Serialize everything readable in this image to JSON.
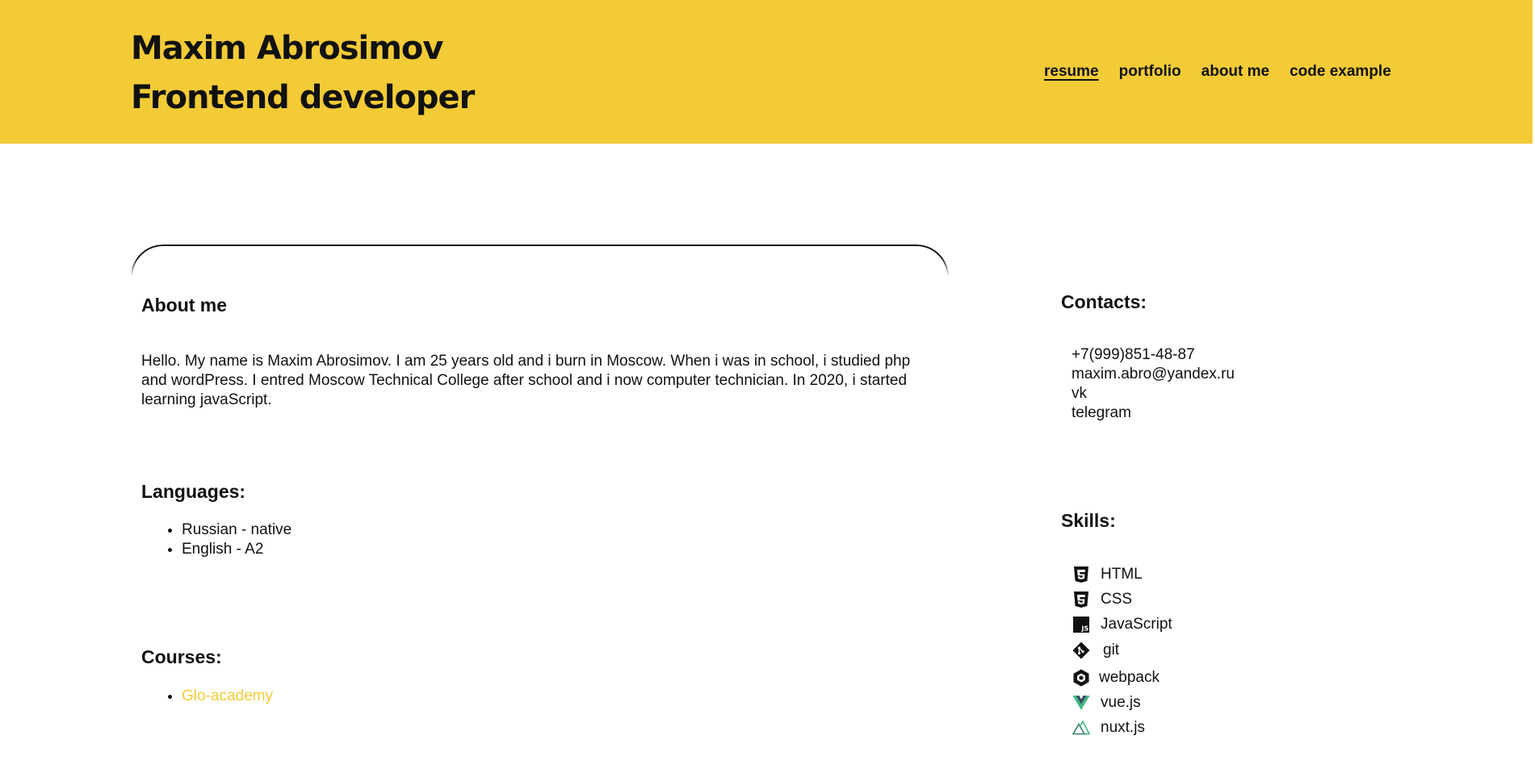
{
  "header": {
    "name": "Maxim Abrosimov",
    "role": "Frontend developer",
    "nav": [
      {
        "label": "resume",
        "active": true
      },
      {
        "label": "portfolio",
        "active": false
      },
      {
        "label": "about me",
        "active": false
      },
      {
        "label": "code example",
        "active": false
      }
    ]
  },
  "about": {
    "heading": "About me",
    "text": "Hello. My name is Maxim Abrosimov. I am 25 years old and i burn in Moscow. When i was in school, i studied php and wordPress. I entred Moscow Technical College after school and i now computer technician. In 2020, i started learning javaScript."
  },
  "languages": {
    "heading": "Languages:",
    "items": [
      "Russian - native",
      "English - A2"
    ]
  },
  "courses": {
    "heading": "Courses:",
    "items": [
      "Glo-academy"
    ]
  },
  "contacts": {
    "heading": "Contacts:",
    "phone": "+7(999)851-48-87",
    "email": "maxim.abro@yandex.ru",
    "vk": "vk",
    "telegram": "telegram"
  },
  "skills": {
    "heading": "Skills:",
    "items": [
      {
        "label": "HTML",
        "icon": "html5-icon"
      },
      {
        "label": "CSS",
        "icon": "css3-icon"
      },
      {
        "label": "JavaScript",
        "icon": "javascript-icon"
      },
      {
        "label": "git",
        "icon": "git-icon"
      },
      {
        "label": "webpack",
        "icon": "webpack-icon"
      },
      {
        "label": "vue.js",
        "icon": "vue-icon"
      },
      {
        "label": "nuxt.js",
        "icon": "nuxt-icon"
      }
    ]
  },
  "colors": {
    "accent": "#f3cb37",
    "text": "#111111",
    "vue": "#41b883",
    "nuxt": "#3b8070"
  }
}
